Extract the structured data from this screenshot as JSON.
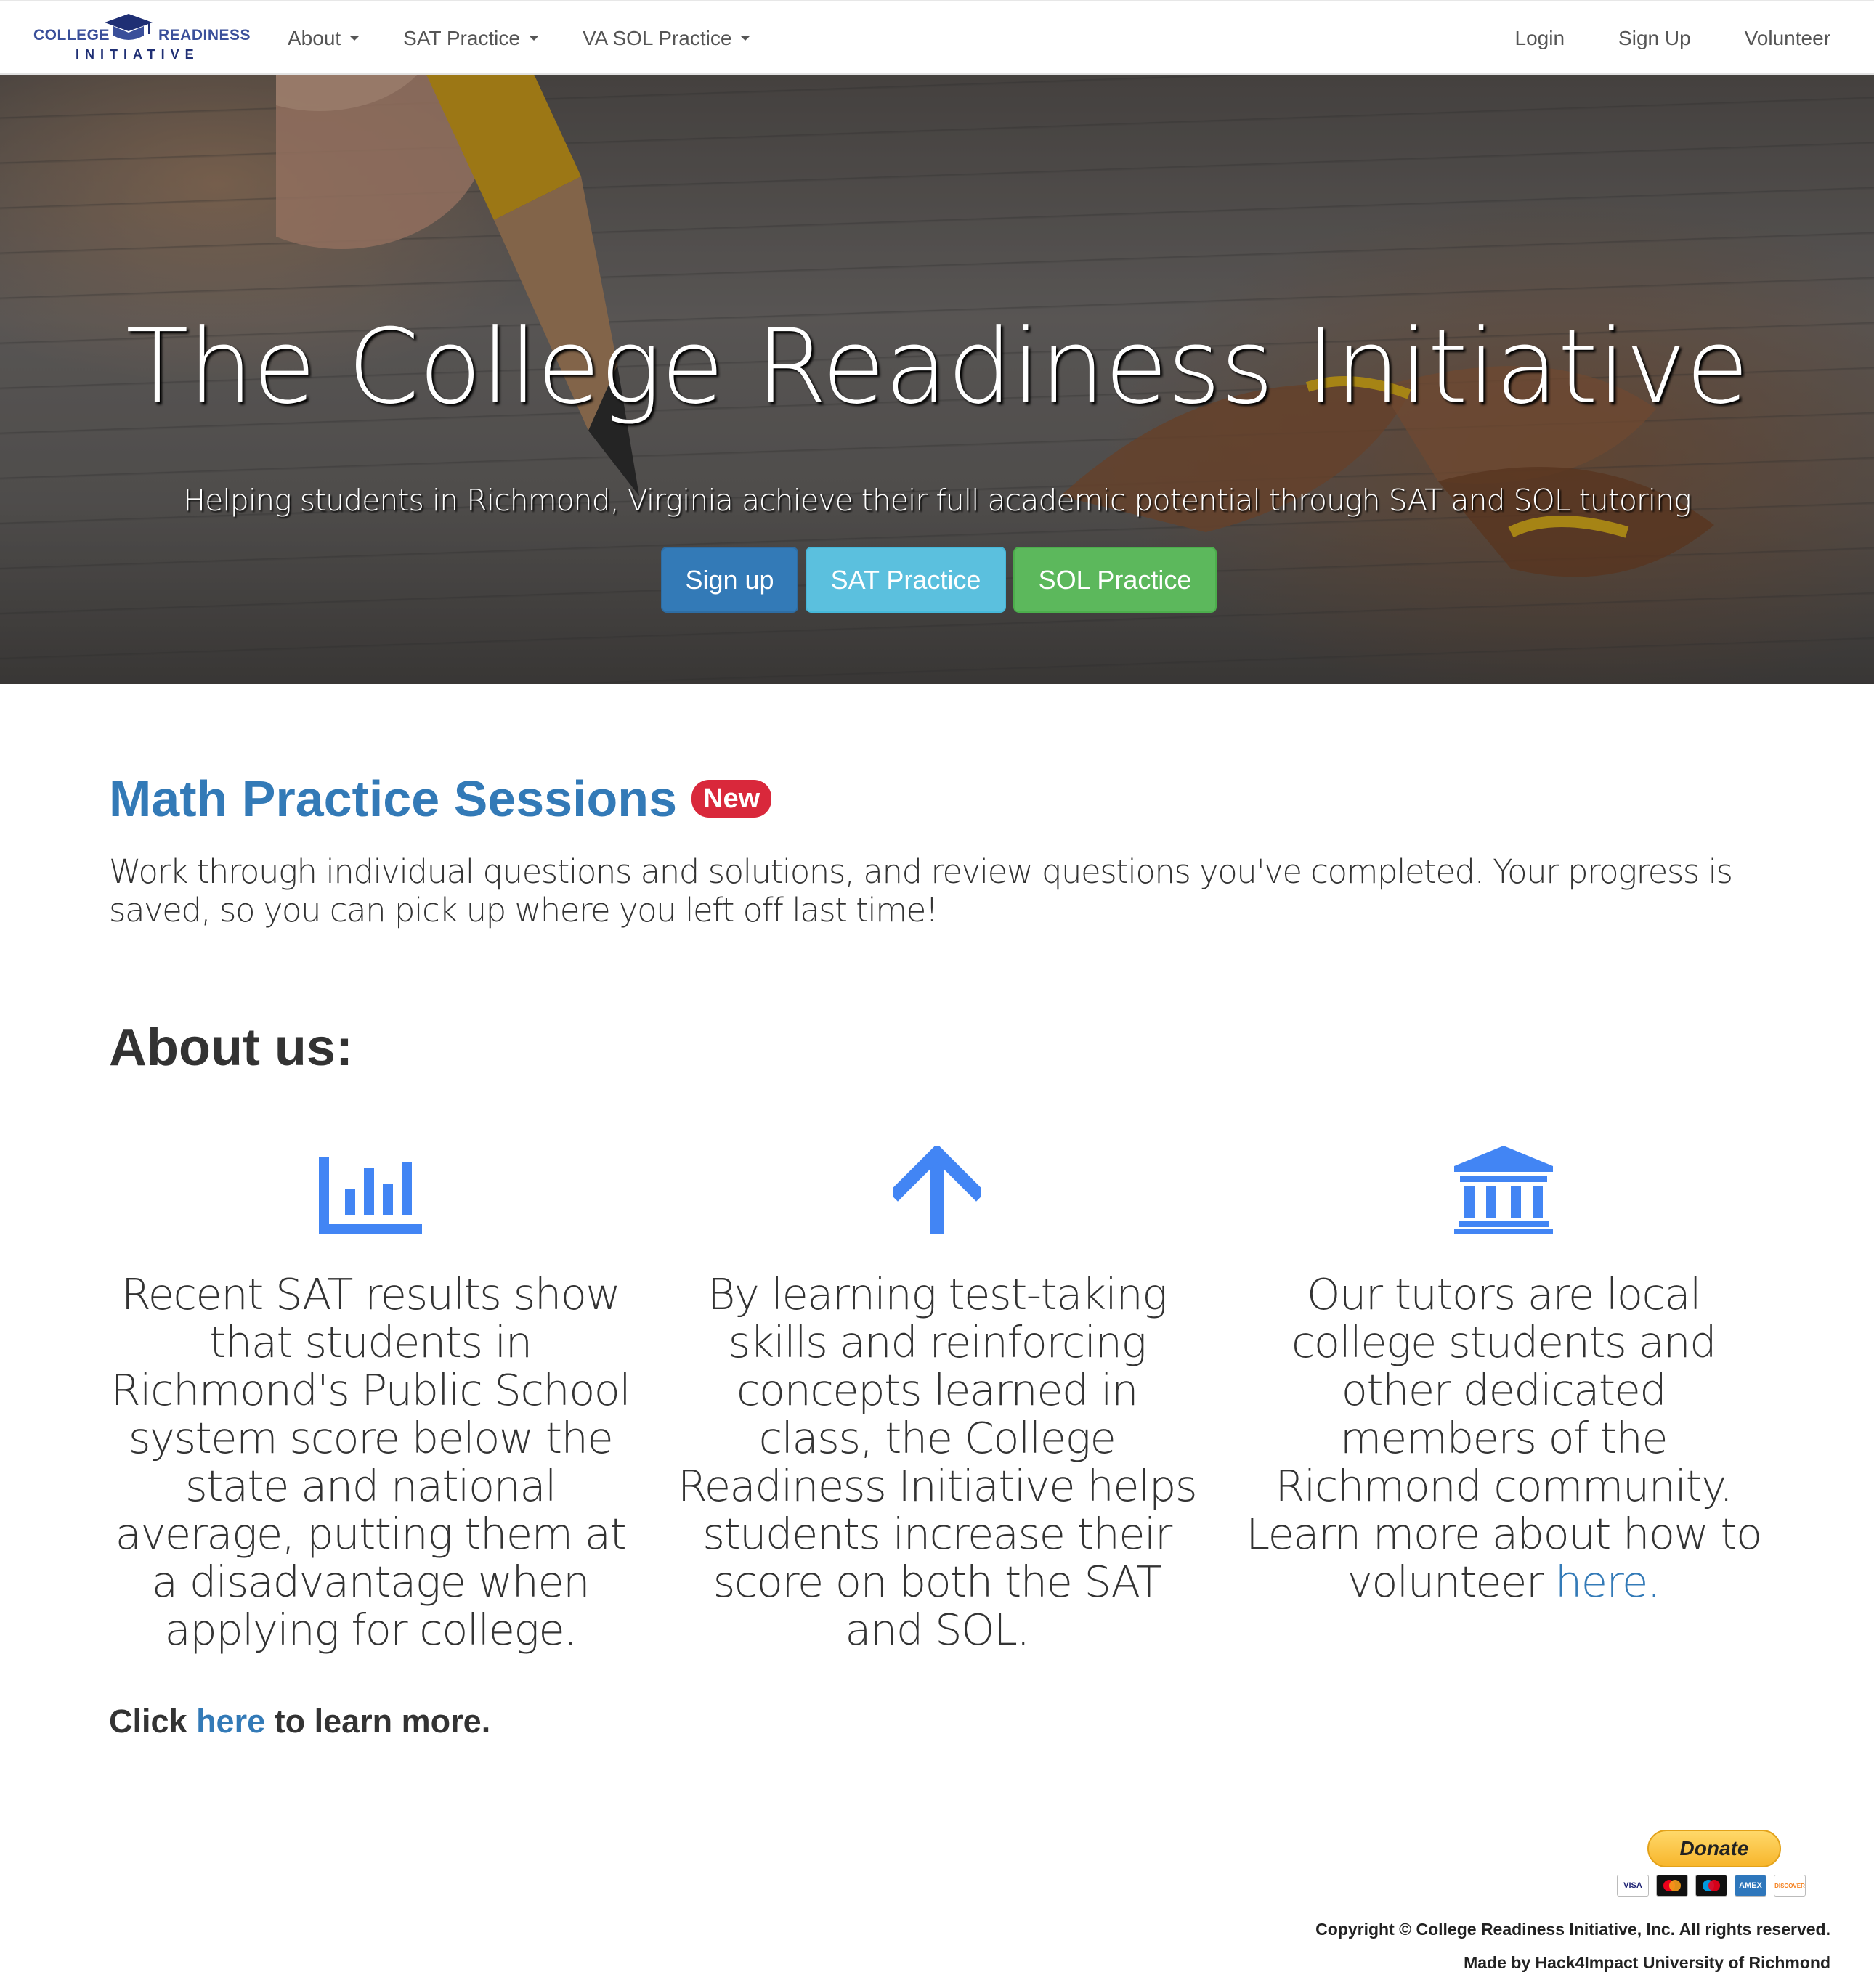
{
  "nav": {
    "logo": {
      "left_word": "COLLEGE",
      "right_word": "READINESS",
      "bottom_word": "INITIATIVE"
    },
    "left_items": [
      "About",
      "SAT Practice",
      "VA SOL Practice"
    ],
    "right_items": [
      "Login",
      "Sign Up",
      "Volunteer"
    ]
  },
  "hero": {
    "title": "The College Readiness Initiative",
    "subtitle": "Helping students in Richmond, Virginia achieve their full academic potential through SAT and SOL tutoring",
    "buttons": {
      "signup": "Sign up",
      "sat": "SAT Practice",
      "sol": "SOL Practice"
    }
  },
  "math": {
    "title": "Math Practice Sessions",
    "badge": "New",
    "description": "Work through individual questions and solutions, and review questions you've completed. Your progress is saved, so you can pick up where you left off last time!"
  },
  "about": {
    "title": "About us:",
    "columns": [
      {
        "icon": "bar-chart-icon",
        "text": "Recent SAT results show that students in Richmond's Public School system score below the state and national average, putting them at a disadvantage when applying for college."
      },
      {
        "icon": "arrow-up-icon",
        "text": "By learning test-taking skills and reinforcing concepts learned in class, the College Readiness Initiative helps students increase their score on both the SAT and SOL."
      },
      {
        "icon": "institution-icon",
        "text_before": "Our tutors are local college students and other dedicated members of the Richmond community. Learn more about how to volunteer ",
        "link": "here."
      }
    ],
    "learn_more": {
      "before": "Click ",
      "link": "here",
      "after": " to learn more."
    }
  },
  "donate": {
    "label": "Donate",
    "cards": [
      "VISA",
      "MC",
      "Maestro",
      "AMEX",
      "DISCOVER"
    ]
  },
  "footer": {
    "copyright": "Copyright © College Readiness Initiative, Inc. All rights reserved.",
    "made_by": "Made by Hack4Impact University of Richmond"
  },
  "colors": {
    "link": "#337ab7",
    "icon": "#4285f4",
    "badge": "#d9283b"
  }
}
